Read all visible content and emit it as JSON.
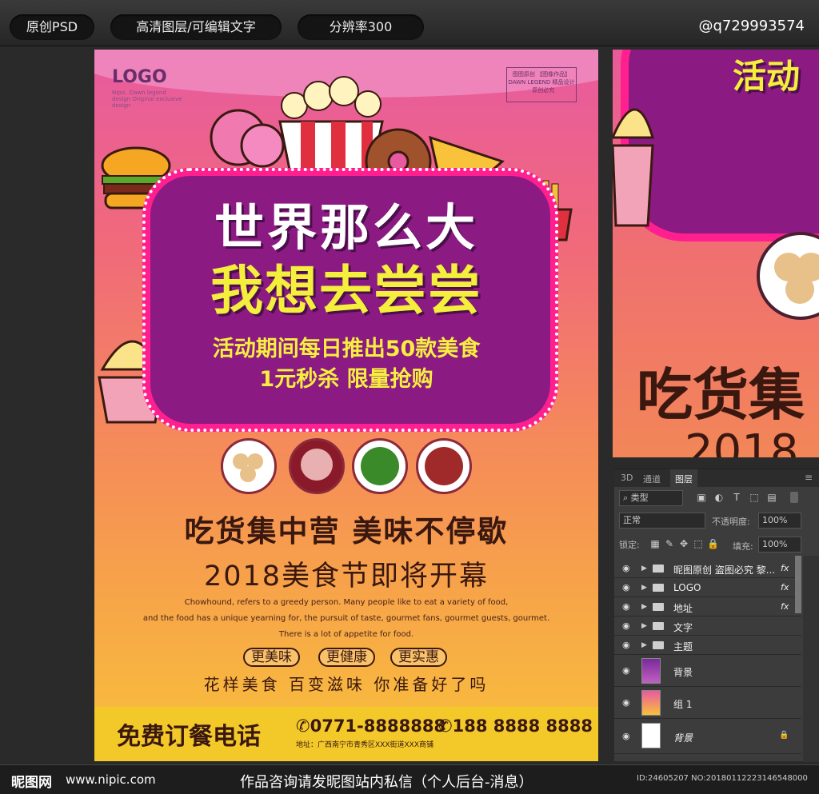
{
  "header": {
    "pill1": "原创PSD",
    "pill2": "高清图层/可编辑文字",
    "pill3": "分辨率300",
    "contact": "@q729993574"
  },
  "poster": {
    "logo": "LOGO",
    "logo_sub": "Nipic. Dawn legend design Original exclusive design",
    "brand_seal": "图图原创 【图像作品】 DAWN LEGEND 精品设计 · 原创必究",
    "headline1": "世界那么大",
    "headline2": "我想去尝尝",
    "sub1": "活动期间每日推出50款美食",
    "sub2": "1元秒杀 限量抢购",
    "slogan": "吃货集中营  美味不停歇",
    "year_line": "2018美食节即将开幕",
    "english": [
      "Chowhound, refers to a greedy person. Many people like to eat a variety of food,",
      "and the food has a unique yearning for, the pursuit of taste, gourmet fans, gourmet guests, gourmet.",
      "There is a lot of appetite for food."
    ],
    "tags": [
      "更美味",
      "更健康",
      "更实惠"
    ],
    "tagline": "花样美食 百变滋味 你准备好了吗",
    "order_label": "免费订餐电话",
    "phone1": "✆0771-8888888",
    "phone2": "✆188 8888 8888",
    "address": "地址：广西南宁市青秀区XXX街道XXX商铺"
  },
  "zoom": {
    "headline": "活动",
    "slogan": "吃货集",
    "year": "2018"
  },
  "layers_panel": {
    "tabs": [
      "3D",
      "通道",
      "图层"
    ],
    "filter_kind": "类型",
    "blend_mode": "正常",
    "opacity_label": "不透明度:",
    "opacity_value": "100%",
    "lock_label": "锁定:",
    "fill_label": "填充:",
    "fill_value": "100%",
    "layers": [
      {
        "name": "昵图原创 盗图必究 黎...",
        "type": "group",
        "fx": "fx"
      },
      {
        "name": "LOGO",
        "type": "group",
        "fx": "fx"
      },
      {
        "name": "地址",
        "type": "group",
        "fx": "fx"
      },
      {
        "name": "文字",
        "type": "group",
        "fx": ""
      },
      {
        "name": "主题",
        "type": "group",
        "fx": ""
      },
      {
        "name": "背景",
        "type": "image",
        "fx": ""
      },
      {
        "name": "组 1",
        "type": "image",
        "fx": ""
      },
      {
        "name": "背景",
        "type": "image",
        "fx": ""
      }
    ]
  },
  "footer": {
    "site_logo": "昵图网",
    "url": "www.nipic.com",
    "message": "作品咨询请发昵图站内私信（个人后台-消息）",
    "id_text": "ID:24605207 NO:20180112223146548000"
  },
  "colors": {
    "frame_purple": "#8b1a82",
    "frame_pink": "#ff1f8e",
    "headline_yellow": "#f4ef3c"
  }
}
